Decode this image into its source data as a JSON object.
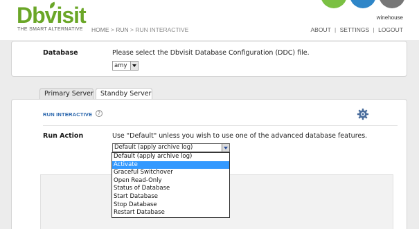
{
  "brand": {
    "logo_text": "Dbvisit",
    "tagline": "THE SMART ALTERNATIVE",
    "accent": "#6aa627"
  },
  "breadcrumb": {
    "home": "HOME",
    "sep1": ">",
    "run": "RUN",
    "sep2": ">",
    "current": "RUN INTERACTIVE"
  },
  "user": {
    "name": "winehouse"
  },
  "topnav": {
    "about": "ABOUT",
    "sep": "|",
    "settings": "SETTINGS",
    "logout": "LOGOUT"
  },
  "database": {
    "label": "Database",
    "instruction": "Please select the Dbvisit Database Configuration (DDC) file.",
    "selected": "amy"
  },
  "tabs": [
    {
      "label": "Primary Server",
      "active": false
    },
    {
      "label": "Standby Server",
      "active": true
    }
  ],
  "section": {
    "title": "RUN INTERACTIVE",
    "help": "?",
    "run_action_label": "Run Action",
    "run_action_hint": "Use \"Default\" unless you wish to use one of the advanced database features.",
    "selected": "Default (apply archive log)"
  },
  "dropdown": {
    "options": [
      "Default (apply archive log)",
      "Activate",
      "Graceful Switchover",
      "Open Read-Only",
      "Status of Database",
      "Start Database",
      "Stop Database",
      "Restart Database"
    ],
    "highlighted": "Activate",
    "highlight_color": "#3399ff"
  },
  "icons": [
    "help-icon",
    "gear-icon",
    "chevron-down-icon"
  ]
}
